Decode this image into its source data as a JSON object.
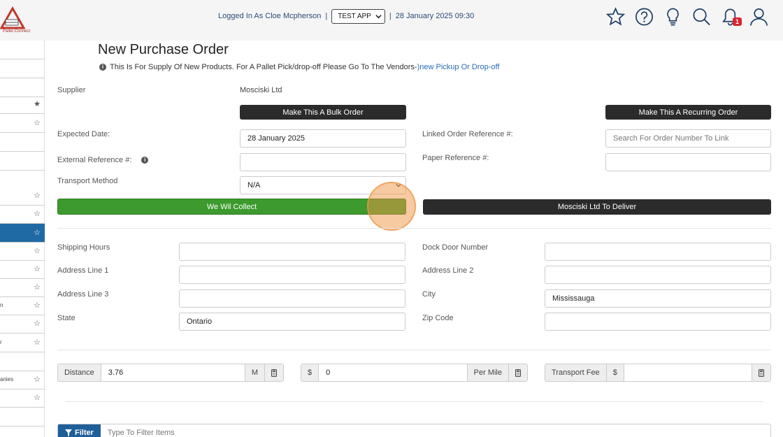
{
  "header": {
    "logo_text": "Pallet Connect",
    "logged_in_label": "Logged In As Cloe Mcpherson",
    "separator": "|",
    "app_selected": "TEST APP",
    "datetime": "28 January 2025 09:30",
    "notification_count": "1"
  },
  "sidebar": {
    "stubs": [
      "n",
      "r",
      "anies"
    ]
  },
  "page": {
    "title": "New Purchase Order",
    "notice_text": "This Is For Supply Of New Products. For A Pallet Pick/drop-off Please Go To The Vendors-",
    "notice_link": ")new Pickup Or Drop-off"
  },
  "form": {
    "supplier_label": "Supplier",
    "supplier_value": "Mosciski Ltd",
    "bulk_order_button": "Make This A Bulk Order",
    "recurring_order_button": "Make This A Recurring Order",
    "expected_date_label": "Expected Date:",
    "expected_date_value": "28 January 2025",
    "linked_ref_label": "Linked Order Reference #:",
    "linked_ref_placeholder": "Search For Order Number To Link",
    "external_ref_label": "External Reference #:",
    "paper_ref_label": "Paper Reference #:",
    "transport_method_label": "Transport Method",
    "transport_method_value": "N/A",
    "we_collect_button": "We Wil Collect",
    "supplier_deliver_button": "Mosciski Ltd To Deliver",
    "shipping_hours_label": "Shipping Hours",
    "dock_door_label": "Dock Door Number",
    "address1_label": "Address Line 1",
    "address2_label": "Address Line 2",
    "address3_label": "Address Line 3",
    "city_label": "City",
    "city_value": "Mississauga",
    "state_label": "State",
    "state_value": "Ontario",
    "zip_label": "Zip Code"
  },
  "transport": {
    "distance_label": "Distance",
    "distance_value": "3.76",
    "distance_unit": "M",
    "currency": "$",
    "rate_value": "0",
    "rate_unit": "Per Mile",
    "fee_label": "Transport Fee",
    "fee_currency": "$"
  },
  "filter": {
    "button_label": "Filter",
    "placeholder": "Type To Filter Items"
  }
}
